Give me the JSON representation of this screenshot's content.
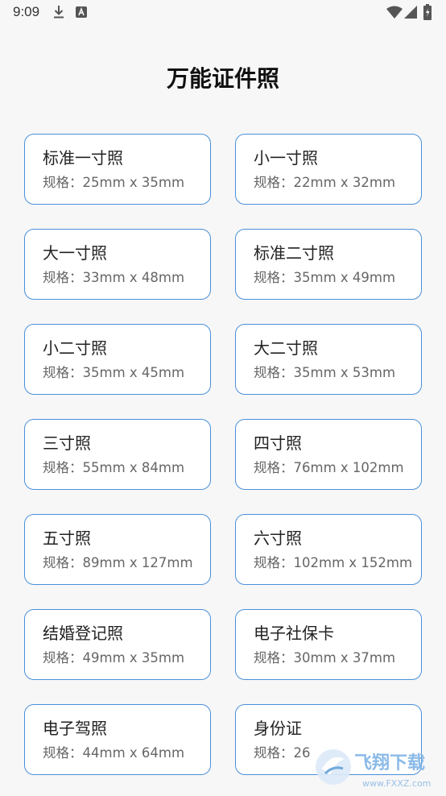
{
  "status_bar": {
    "time": "9:09",
    "icons": [
      "download-icon",
      "a-badge-icon",
      "wifi-icon",
      "signal-icon",
      "battery-charging-icon"
    ]
  },
  "page": {
    "title": "万能证件照"
  },
  "cards": [
    {
      "name": "标准一寸照",
      "spec": "规格：25mm x 35mm"
    },
    {
      "name": "小一寸照",
      "spec": "规格：22mm x 32mm"
    },
    {
      "name": "大一寸照",
      "spec": "规格：33mm x 48mm"
    },
    {
      "name": "标准二寸照",
      "spec": "规格：35mm x 49mm"
    },
    {
      "name": "小二寸照",
      "spec": "规格：35mm x 45mm"
    },
    {
      "name": "大二寸照",
      "spec": "规格：35mm x 53mm"
    },
    {
      "name": "三寸照",
      "spec": "规格：55mm x 84mm"
    },
    {
      "name": "四寸照",
      "spec": "规格：76mm x 102mm"
    },
    {
      "name": "五寸照",
      "spec": "规格：89mm x 127mm"
    },
    {
      "name": "六寸照",
      "spec": "规格：102mm x 152mm"
    },
    {
      "name": "结婚登记照",
      "spec": "规格：49mm x 35mm"
    },
    {
      "name": "电子社保卡",
      "spec": "规格：30mm x 37mm"
    },
    {
      "name": "电子驾照",
      "spec": "规格：44mm x 64mm"
    },
    {
      "name": "身份证",
      "spec": "规格：26"
    }
  ],
  "watermark": {
    "brand": "飞翔下载",
    "url": "www.FXXZ.com"
  },
  "colors": {
    "card_border": "#4a90d9",
    "background": "#f7f7f8"
  }
}
